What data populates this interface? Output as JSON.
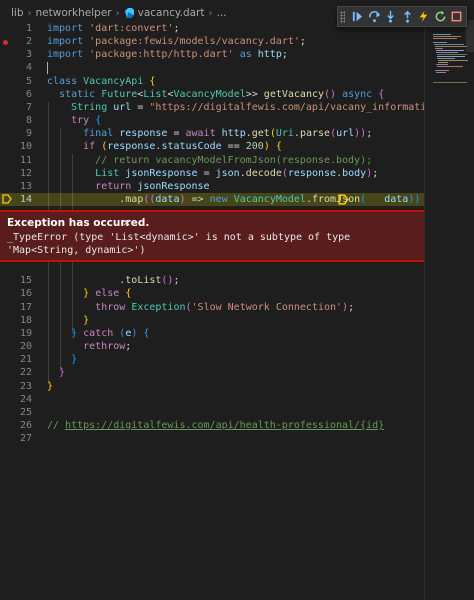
{
  "breadcrumb": {
    "items": [
      "lib",
      "networkhelper",
      "vacancy.dart",
      "..."
    ]
  },
  "debug_toolbar": {
    "buttons": [
      "grip",
      "continue",
      "step-over",
      "step-into",
      "step-out",
      "hot-reload",
      "restart",
      "stop"
    ]
  },
  "exception": {
    "title": "Exception has occurred.",
    "close": "×",
    "message": "_TypeError (type 'List<dynamic>' is not a subtype of type 'Map<String, dynamic>')"
  },
  "editor": {
    "lines": [
      {
        "num": "1",
        "tokens": [
          [
            "kw",
            "import"
          ],
          [
            "pun",
            " "
          ],
          [
            "str",
            "'dart:convert'"
          ],
          [
            "pun",
            ";"
          ]
        ]
      },
      {
        "num": "2",
        "tokens": [
          [
            "kw",
            "import"
          ],
          [
            "pun",
            " "
          ],
          [
            "str",
            "'package:fewis/models/vacancy.dart'"
          ],
          [
            "pun",
            ";"
          ]
        ]
      },
      {
        "num": "3",
        "tokens": [
          [
            "kw",
            "import"
          ],
          [
            "pun",
            " "
          ],
          [
            "str",
            "'package:http/http.dart'"
          ],
          [
            "pun",
            " "
          ],
          [
            "kw",
            "as"
          ],
          [
            "pun",
            " "
          ],
          [
            "var",
            "http"
          ],
          [
            "pun",
            ";"
          ]
        ]
      },
      {
        "num": "4",
        "tokens": []
      },
      {
        "num": "5",
        "tokens": [
          [
            "kw",
            "class"
          ],
          [
            "pun",
            " "
          ],
          [
            "typ",
            "VacancyApi"
          ],
          [
            "pun",
            " "
          ],
          [
            "br1",
            "{"
          ]
        ]
      },
      {
        "num": "6",
        "tokens": [
          [
            "pun",
            "  "
          ],
          [
            "kw",
            "static"
          ],
          [
            "pun",
            " "
          ],
          [
            "typ",
            "Future"
          ],
          [
            "pun",
            "<"
          ],
          [
            "typ",
            "List"
          ],
          [
            "pun",
            "<"
          ],
          [
            "typ",
            "VacancyModel"
          ],
          [
            "pun",
            ">> "
          ],
          [
            "fn",
            "getVacancy"
          ],
          [
            "br2",
            "()"
          ],
          [
            "pun",
            " "
          ],
          [
            "kw",
            "async"
          ],
          [
            "pun",
            " "
          ],
          [
            "br2",
            "{"
          ]
        ]
      },
      {
        "num": "7",
        "tokens": [
          [
            "pun",
            "    "
          ],
          [
            "typ",
            "String"
          ],
          [
            "pun",
            " "
          ],
          [
            "var",
            "url"
          ],
          [
            "pun",
            " = "
          ],
          [
            "str",
            "\"https://digitalfewis.com/api/vacany_information\""
          ],
          [
            "pun",
            ";"
          ]
        ]
      },
      {
        "num": "8",
        "tokens": [
          [
            "pun",
            "    "
          ],
          [
            "ctl",
            "try"
          ],
          [
            "pun",
            " "
          ],
          [
            "br3",
            "{"
          ]
        ]
      },
      {
        "num": "9",
        "tokens": [
          [
            "pun",
            "      "
          ],
          [
            "kw",
            "final"
          ],
          [
            "pun",
            " "
          ],
          [
            "var",
            "response"
          ],
          [
            "pun",
            " = "
          ],
          [
            "ctl",
            "await"
          ],
          [
            "pun",
            " "
          ],
          [
            "var",
            "http"
          ],
          [
            "pun",
            "."
          ],
          [
            "fn",
            "get"
          ],
          [
            "br1",
            "("
          ],
          [
            "typ",
            "Uri"
          ],
          [
            "pun",
            "."
          ],
          [
            "fn",
            "parse"
          ],
          [
            "br2",
            "("
          ],
          [
            "var",
            "url"
          ],
          [
            "br2",
            "))"
          ],
          [
            "pun",
            ";"
          ]
        ]
      },
      {
        "num": "10",
        "tokens": [
          [
            "pun",
            "      "
          ],
          [
            "ctl",
            "if"
          ],
          [
            "pun",
            " "
          ],
          [
            "br1",
            "("
          ],
          [
            "var",
            "response"
          ],
          [
            "pun",
            "."
          ],
          [
            "var",
            "statusCode"
          ],
          [
            "pun",
            " == "
          ],
          [
            "num",
            "200"
          ],
          [
            "br1",
            ")"
          ],
          [
            "pun",
            " "
          ],
          [
            "br1",
            "{"
          ]
        ]
      },
      {
        "num": "11",
        "tokens": [
          [
            "pun",
            "        "
          ],
          [
            "cmt",
            "// return vacancyModelFromJson(response.body);"
          ]
        ]
      },
      {
        "num": "12",
        "tokens": [
          [
            "pun",
            "        "
          ],
          [
            "typ",
            "List"
          ],
          [
            "pun",
            " "
          ],
          [
            "var",
            "jsonResponse"
          ],
          [
            "pun",
            " = "
          ],
          [
            "var",
            "json"
          ],
          [
            "pun",
            "."
          ],
          [
            "fn",
            "decode"
          ],
          [
            "br2",
            "("
          ],
          [
            "var",
            "response"
          ],
          [
            "pun",
            "."
          ],
          [
            "var",
            "body"
          ],
          [
            "br2",
            ")"
          ],
          [
            "pun",
            ";"
          ]
        ]
      },
      {
        "num": "13",
        "tokens": [
          [
            "pun",
            "        "
          ],
          [
            "ctl",
            "return"
          ],
          [
            "pun",
            " "
          ],
          [
            "var",
            "jsonResponse"
          ]
        ]
      },
      {
        "num": "14",
        "tokens": [
          [
            "pun",
            "            ."
          ],
          [
            "fn",
            "map"
          ],
          [
            "br2",
            "(("
          ],
          [
            "var",
            "data"
          ],
          [
            "br2",
            ")"
          ],
          [
            "pun",
            " => "
          ],
          [
            "kw",
            "new"
          ],
          [
            "pun",
            " "
          ],
          [
            "typ",
            "VacancyModel"
          ],
          [
            "pun",
            "."
          ],
          [
            "fn",
            "fromJson"
          ],
          [
            "br3",
            "("
          ],
          [
            "pun",
            "   "
          ],
          [
            "var",
            "data"
          ],
          [
            "br3",
            "))"
          ]
        ]
      },
      {
        "num": "15",
        "tokens": [
          [
            "pun",
            "            ."
          ],
          [
            "fn",
            "toList"
          ],
          [
            "br2",
            "()"
          ],
          [
            "pun",
            ";"
          ]
        ]
      },
      {
        "num": "16",
        "tokens": [
          [
            "pun",
            "      "
          ],
          [
            "br1",
            "}"
          ],
          [
            "pun",
            " "
          ],
          [
            "ctl",
            "else"
          ],
          [
            "pun",
            " "
          ],
          [
            "br1",
            "{"
          ]
        ]
      },
      {
        "num": "17",
        "tokens": [
          [
            "pun",
            "        "
          ],
          [
            "ctl",
            "throw"
          ],
          [
            "pun",
            " "
          ],
          [
            "typ",
            "Exception"
          ],
          [
            "br2",
            "("
          ],
          [
            "str",
            "'Slow Network Connection'"
          ],
          [
            "br2",
            ")"
          ],
          [
            "pun",
            ";"
          ]
        ]
      },
      {
        "num": "18",
        "tokens": [
          [
            "pun",
            "      "
          ],
          [
            "br1",
            "}"
          ]
        ]
      },
      {
        "num": "19",
        "tokens": [
          [
            "pun",
            "    "
          ],
          [
            "br3",
            "}"
          ],
          [
            "pun",
            " "
          ],
          [
            "ctl",
            "catch"
          ],
          [
            "pun",
            " "
          ],
          [
            "br3",
            "("
          ],
          [
            "var",
            "e"
          ],
          [
            "br3",
            ")"
          ],
          [
            "pun",
            " "
          ],
          [
            "br3",
            "{"
          ]
        ]
      },
      {
        "num": "20",
        "tokens": [
          [
            "pun",
            "      "
          ],
          [
            "ctl",
            "rethrow"
          ],
          [
            "pun",
            ";"
          ]
        ]
      },
      {
        "num": "21",
        "tokens": [
          [
            "pun",
            "    "
          ],
          [
            "br3",
            "}"
          ]
        ]
      },
      {
        "num": "22",
        "tokens": [
          [
            "pun",
            "  "
          ],
          [
            "br2",
            "}"
          ]
        ]
      },
      {
        "num": "23",
        "tokens": [
          [
            "br1",
            "}"
          ]
        ]
      },
      {
        "num": "24",
        "tokens": []
      },
      {
        "num": "25",
        "tokens": []
      },
      {
        "num": "26",
        "tokens": [
          [
            "cmt",
            "// "
          ],
          [
            "link",
            "https://digitalfewis.com/api/health-professional/{id}"
          ]
        ]
      },
      {
        "num": "27",
        "tokens": []
      }
    ]
  }
}
